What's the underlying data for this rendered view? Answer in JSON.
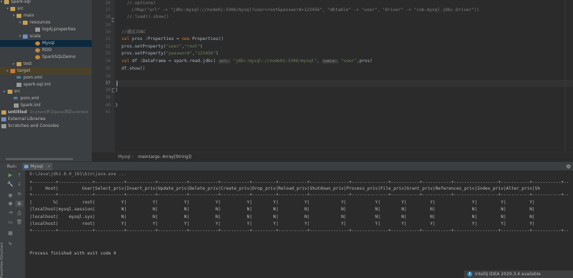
{
  "tree": {
    "rows": [
      {
        "label": "spark-sql",
        "icon": "folder-icon",
        "indent": 0,
        "arrow": "expanded"
      },
      {
        "label": "src",
        "icon": "folder-icon",
        "indent": 1,
        "arrow": "expanded"
      },
      {
        "label": "main",
        "icon": "folder-icon",
        "indent": 2,
        "arrow": "expanded"
      },
      {
        "label": "resources",
        "icon": "resources-folder-icon",
        "indent": 3,
        "arrow": "expanded"
      },
      {
        "label": "log4j.properties",
        "icon": "properties-file-icon",
        "indent": 5,
        "arrow": ""
      },
      {
        "label": "scala",
        "icon": "source-folder-icon",
        "indent": 3,
        "arrow": "expanded"
      },
      {
        "label": "Mysql",
        "icon": "scala-object-icon",
        "indent": 5,
        "arrow": "",
        "selected": true
      },
      {
        "label": "RDD",
        "icon": "scala-object-icon",
        "indent": 5,
        "arrow": ""
      },
      {
        "label": "SparkSQLDemo",
        "icon": "scala-object-icon",
        "indent": 5,
        "arrow": ""
      },
      {
        "label": "test",
        "icon": "folder-icon",
        "indent": 2,
        "arrow": "collapsed"
      },
      {
        "label": "target",
        "icon": "target-folder-icon",
        "indent": 1,
        "arrow": "collapsed",
        "highlight": true
      },
      {
        "label": "pom.xml",
        "icon": "maven-icon",
        "indent": 2,
        "arrow": ""
      },
      {
        "label": "spark-sql.iml",
        "icon": "iml-file-icon",
        "indent": 2,
        "arrow": ""
      },
      {
        "label": "src",
        "icon": "folder-icon",
        "indent": 0.5,
        "arrow": "collapsed"
      },
      {
        "label": "pom.xml",
        "icon": "maven-icon",
        "indent": 1.5,
        "arrow": ""
      },
      {
        "label": "Spark.iml",
        "icon": "iml-file-icon",
        "indent": 1.5,
        "arrow": ""
      },
      {
        "label": "untitled",
        "icon": "folder-icon",
        "indent": -0.5,
        "arrow": "collapsed",
        "bold": true,
        "suffix": "D:\\chen\\学习\\Java\\项目\\untitled"
      },
      {
        "label": "External Libraries",
        "icon": "libraries-icon",
        "indent": -0.5,
        "arrow": "collapsed"
      },
      {
        "label": "Scratches and Consoles",
        "icon": "scratches-icon",
        "indent": -0.5,
        "arrow": ""
      }
    ]
  },
  "editor": {
    "line_numbers": [
      "26",
      "27",
      "28",
      "29",
      "30",
      "31",
      "32",
      "33",
      "34",
      "35",
      "36",
      "37",
      "38",
      "39",
      "40",
      "41"
    ],
    "active_line": "37"
  },
  "breadcrumb": {
    "object": "Mysql",
    "method": "main(args: Array[String])"
  },
  "run": {
    "label": "Run:",
    "tab": "Mysql"
  },
  "console": {
    "command": "D:\\Java\\jdk1.8.0_181\\bin\\java.exe ...",
    "separator": "+---------+-------------+-----------+-----------+-----------+-----------+-----------+---------+-----------+---------------+--------------+-----------+-----------+-----------------+-----------+-----------+--",
    "header": "|     Host|         User|Select_priv|Insert_priv|Update_priv|Delete_priv|Create_priv|Drop_priv|Reload_priv|Shutdown_priv|Process_priv|File_priv|Grant_priv|References_priv|Index_priv|Alter_priv|Sh",
    "rows": [
      "|        %|         root|          Y|          Y|          Y|          Y|          Y|        Y|          Y|            Y|           Y|        Y|         Y|              Y|         Y|         Y|",
      "|localhost|mysql.session|          N|          N|          N|          N|          N|        N|          N|            N|           N|        N|         N|              N|         N|         N|",
      "|localhost|    mysql.sys|          N|          N|          N|          N|          N|        N|          N|            N|           N|        N|         N|              N|         N|         N|",
      "|localhost|         root|          Y|          Y|          Y|          Y|          Y|        Y|          Y|            Y|           Y|        Y|         Y|              Y|         Y|         Y|"
    ],
    "exit": "Process finished with exit code 0"
  },
  "notification": {
    "text": "IntelliJ IDEA 2020.3.4 available"
  },
  "sidebar_labels": {
    "structure": "Structure",
    "favorites": "Favorites"
  }
}
